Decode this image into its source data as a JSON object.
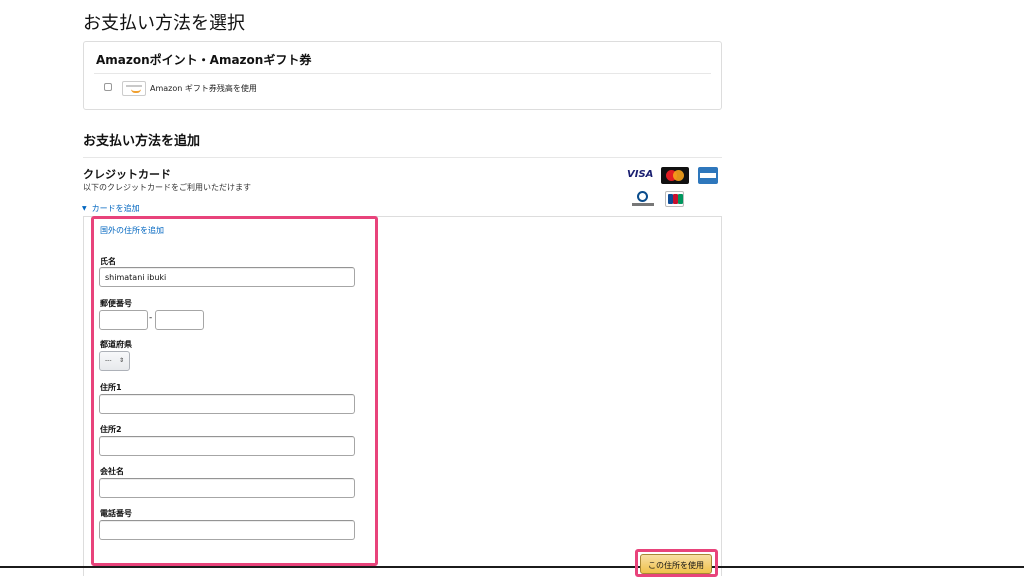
{
  "page": {
    "title": "お支払い方法を選択"
  },
  "gift": {
    "title": "Amazonポイント・Amazonギフト券",
    "checkbox_label": "Amazon ギフト券残高を使用"
  },
  "add_payment": {
    "title": "お支払い方法を追加"
  },
  "credit_card": {
    "title": "クレジットカード",
    "subtitle": "以下のクレジットカードをご利用いただけます",
    "logos": [
      "VISA",
      "MasterCard",
      "American Express",
      "Diners Club International",
      "JCB"
    ],
    "add_card_link": "カードを追加"
  },
  "address_form": {
    "intl_link": "国外の住所を追加",
    "name_label": "氏名",
    "name_value": "shimatani ibuki",
    "postal_label": "郵便番号",
    "postal_separator": "-",
    "prefecture_label": "都道府県",
    "prefecture_value": "---",
    "address1_label": "住所1",
    "address2_label": "住所2",
    "company_label": "会社名",
    "phone_label": "電話番号",
    "submit_label": "この住所を使用"
  },
  "colors": {
    "highlight": "#e8437b",
    "link": "#0066c0",
    "button": "#f0c14b"
  }
}
